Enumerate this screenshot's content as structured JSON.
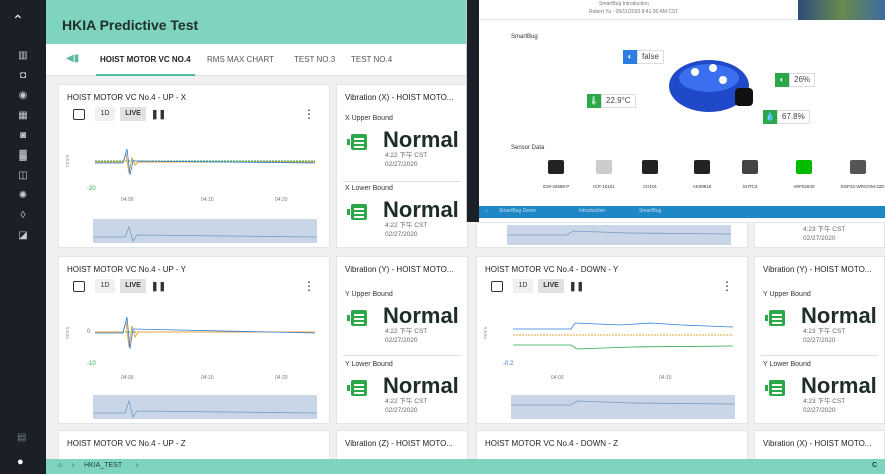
{
  "sidebar": {
    "logo_glyph": "⌃",
    "items": [
      "▥",
      "◘",
      "◉",
      "▦",
      "◙",
      "▓",
      "◫",
      "✺",
      "◊",
      "◪"
    ],
    "settings_glyph": "▤",
    "user_glyph": "●"
  },
  "header": {
    "title": "HKIA Predictive Test"
  },
  "tabs": [
    "HOIST MOTOR VC NO.4",
    "RMS MAX CHART",
    "TEST NO.3",
    "TEST NO.4"
  ],
  "toolbar": {
    "range_label": "1D",
    "live_label": "LIVE",
    "pause_label": "❚❚",
    "more_label": "⋮"
  },
  "charts": [
    {
      "title": "HOIST MOTOR VC No.4 - UP - X",
      "y_unit": "mm/s",
      "y_top": "",
      "y_bottom": "-20",
      "x_ticks": [
        "04:00",
        "04:10",
        "04:20"
      ]
    },
    {
      "title": "HOIST MOTOR VC No.4 - UP - Y",
      "y_unit": "mm/s",
      "y_top": "0",
      "y_bottom": "-10",
      "x_ticks": [
        "04:00",
        "04:10",
        "04:20"
      ]
    },
    {
      "title": "HOIST MOTOR VC No.4 - DOWN - Y",
      "y_unit": "mm/s",
      "y_top": "",
      "y_bottom": "-0.2",
      "x_ticks": [
        "04:00",
        "04:15"
      ]
    },
    {
      "title": "HOIST MOTOR VC No.4 - UP - Z"
    },
    {
      "title": "HOIST MOTOR VC No.4 - DOWN - Z"
    }
  ],
  "vib_cards": [
    {
      "title": "Vibration (X) - HOIST MOTO...",
      "upper_label": "X Upper Bound",
      "upper_status": "Normal",
      "upper_time": "4:22 下午 CST",
      "upper_date": "02/27/2020",
      "lower_label": "X Lower Bound",
      "lower_status": "Normal",
      "lower_time": "4:22 下午 CST",
      "lower_date": "02/27/2020"
    },
    {
      "title": "Vibration (Y) - HOIST MOTO...",
      "upper_label": "Y Upper Bound",
      "upper_status": "Normal",
      "upper_time": "4:22 下午 CST",
      "upper_date": "02/27/2020",
      "lower_label": "Y Lower Bound",
      "lower_status": "Normal",
      "lower_time": "4:22 下午 CST",
      "lower_date": "02/27/2020"
    },
    {
      "title": "Vibration (Y) - HOIST MOTO...",
      "upper_label": "Y Upper Bound",
      "upper_status": "Normal",
      "upper_time": "4:23 下午 CST",
      "upper_date": "02/27/2020",
      "lower_label": "Y Lower Bound",
      "lower_status": "Normal",
      "lower_time": "4:23 下午 CST",
      "lower_date": "02/27/2020"
    },
    {
      "title": "Vibration (Z) - HOIST MOTO..."
    },
    {
      "title": "Vibration (X) - HOIST MOTO..."
    },
    {
      "top_time": "4:23 下午 CST",
      "top_date": "02/27/2020"
    }
  ],
  "breadcrumb": {
    "home": "⌂",
    "sep": "›",
    "item": "HKIA_TEST"
  },
  "overlay": {
    "top_line1": "SmartBug Introduction",
    "top_line2": "Robert Yu · 09/11/2020 8:41:36 AM CST",
    "section_smartbug": "SmartBug",
    "false_value": "false",
    "temp_value": "22.9°C",
    "pct1": "26%",
    "pct2": "67.8%",
    "section_sensor": "Sensor Data",
    "sensors": [
      "ICM-42688-P",
      "ICP-10101",
      "CH101",
      "AK09918",
      "SHTC3",
      "nRF52840",
      "ESP32-WROOM-32D"
    ],
    "breadcrumb": [
      "SmartBug Demo",
      "Introduction",
      "SmartBug"
    ]
  },
  "footer_right": "C",
  "colors": {
    "accent": "#7fd4c0",
    "sidebar": "#1b2026",
    "status_green": "#2aa84a"
  }
}
